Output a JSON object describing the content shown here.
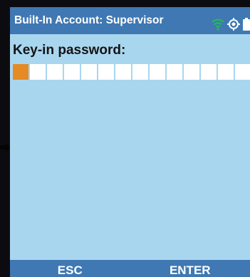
{
  "titlebar": {
    "title": "Built-In Account: Supervisor",
    "icons": [
      "wifi-icon",
      "gps-icon",
      "battery-icon"
    ]
  },
  "password_prompt": {
    "label": "Key-in password:",
    "box_count": 15,
    "active_box_index": 0
  },
  "softkeys": {
    "left_label": "ESC",
    "right_label": "ENTER"
  },
  "colors": {
    "screen_background": "#a9d6ef",
    "bar_background": "#3f78b3",
    "active_box": "#e58a25",
    "wifi_icon": "#27b85a"
  }
}
